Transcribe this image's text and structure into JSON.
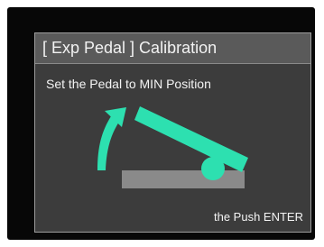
{
  "dialog": {
    "title": "[ Exp Pedal ] Calibration",
    "instruction": "Set the Pedal to MIN Position",
    "footer_hint": "the Push ENTER"
  },
  "illustration": {
    "subject": "expression pedal tilted to minimum (toe-up) position",
    "arrow_direction": "up",
    "accent_color": "#2de0b0",
    "base_color": "#8a8a8a"
  },
  "colors": {
    "screen_background": "#070707",
    "dialog_background": "#3c3c3c",
    "header_background": "#5a5a5a",
    "text": "#f2f2f2"
  }
}
